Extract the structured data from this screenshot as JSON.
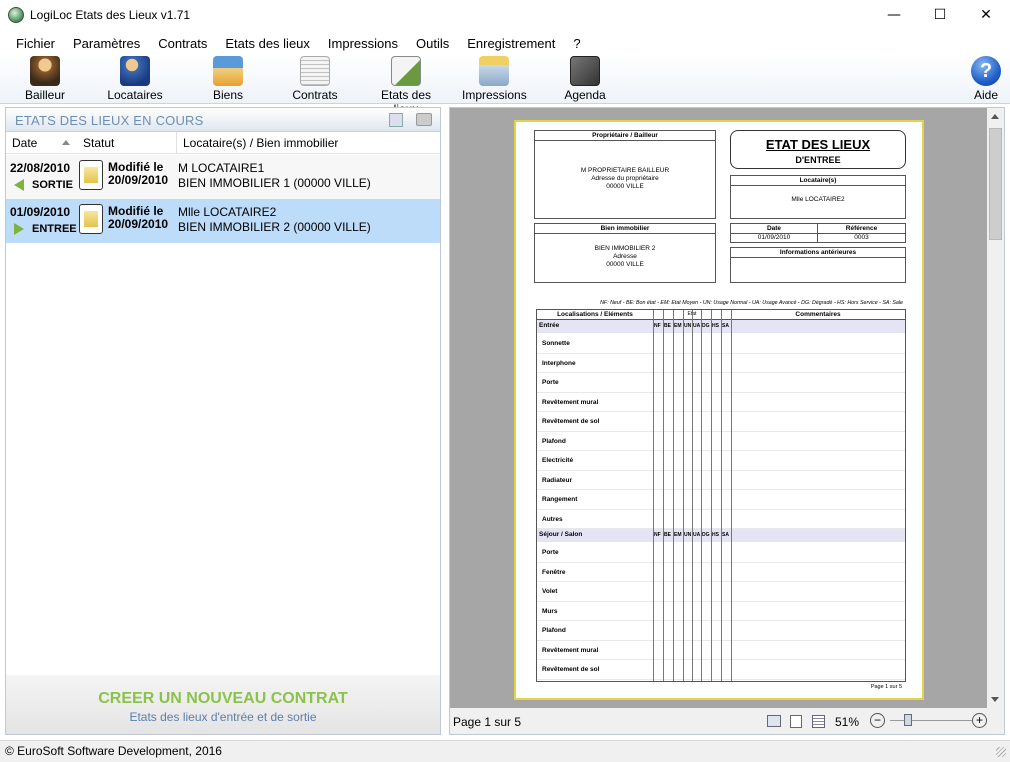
{
  "window": {
    "title": "LogiLoc Etats des Lieux v1.71",
    "minimize": "—",
    "maximize": "☐",
    "close": "✕"
  },
  "menu": [
    "Fichier",
    "Paramètres",
    "Contrats",
    "Etats des lieux",
    "Impressions",
    "Outils",
    "Enregistrement",
    "?"
  ],
  "toolbar": {
    "bailleur": "Bailleur",
    "locataires": "Locataires",
    "biens": "Biens",
    "contrats": "Contrats",
    "etats": "Etats des lieux",
    "impressions": "Impressions",
    "agenda": "Agenda",
    "aide": "Aide",
    "colors": {
      "bailleur": "#8a5a2a",
      "locataires": "#3a6ab0",
      "biens": "#e8a030",
      "contrats": "#c8c8c8",
      "etats": "#6a9a40",
      "impressions": "#8aa8c8",
      "agenda": "#555555",
      "aide": "#2060c8"
    }
  },
  "list": {
    "title": "ETATS DES LIEUX EN COURS",
    "columns": {
      "date": "Date",
      "statut": "Statut",
      "locataire": "Locataire(s) / Bien immobilier"
    },
    "rows": [
      {
        "date": "22/08/2010",
        "type": "SORTIE",
        "statut1": "Modifié le",
        "statut2": "20/09/2010",
        "loc1": "M LOCATAIRE1",
        "loc2": "BIEN IMMOBILIER 1 (00000 VILLE)"
      },
      {
        "date": "01/09/2010",
        "type": "ENTREE",
        "statut1": "Modifié le",
        "statut2": "20/09/2010",
        "loc1": "Mlle LOCATAIRE2",
        "loc2": "BIEN IMMOBILIER 2 (00000 VILLE)"
      }
    ],
    "selected_row_color": "#bcdcfa",
    "new_contract": "CREER UN NOUVEAU CONTRAT",
    "new_contract_sub": "Etats des lieux d'entrée et de sortie"
  },
  "doc": {
    "proprio_h": "Propriétaire / Bailleur",
    "proprio_1": "M PROPRIETAIRE BAILLEUR",
    "proprio_2": "Adresse du propriétaire",
    "proprio_3": "00000 VILLE",
    "title": "ETAT DES LIEUX",
    "subtitle": "D'ENTREE",
    "loc_h": "Locataire(s)",
    "loc_v": "Mlle LOCATAIRE2",
    "bien_h": "Bien immobilier",
    "bien_1": "BIEN IMMOBILIER 2",
    "bien_2": "Adresse",
    "bien_3": "00000 VILLE",
    "date_h": "Date",
    "date_v": "01/09/2010",
    "ref_h": "Référence",
    "ref_v": "0003",
    "info_h": "Informations antérieures",
    "legend": "NF: Neuf - BE: Bon état - EM: Etat Moyen - UN: Usage Normal - UA: Usage Avancé - DG: Dégradé - HS: Hors Service - SA: Sale",
    "col_loc": "Localisations / Eléments",
    "col_etat": "Etat",
    "col_comm": "Commentaires",
    "state_cols": [
      "NF",
      "BE",
      "EM",
      "UN",
      "UA",
      "DG",
      "HS",
      "SA"
    ],
    "sect1": "Entrée",
    "items1": [
      "Sonnette",
      "Interphone",
      "Porte",
      "Revêtement mural",
      "Revêtement de sol",
      "Plafond",
      "Electricité",
      "Radiateur",
      "Rangement",
      "Autres"
    ],
    "sect2": "Séjour / Salon",
    "items2": [
      "Porte",
      "Fenêtre",
      "Volet",
      "Murs",
      "Plafond",
      "Revêtement mural",
      "Revêtement de sol"
    ],
    "page_footer": "Page 1 sur 5"
  },
  "status": {
    "page": "Page 1 sur 5",
    "zoom": "51%",
    "zoom_level": 0.22
  },
  "footer": "© EuroSoft Software Development, 2016"
}
